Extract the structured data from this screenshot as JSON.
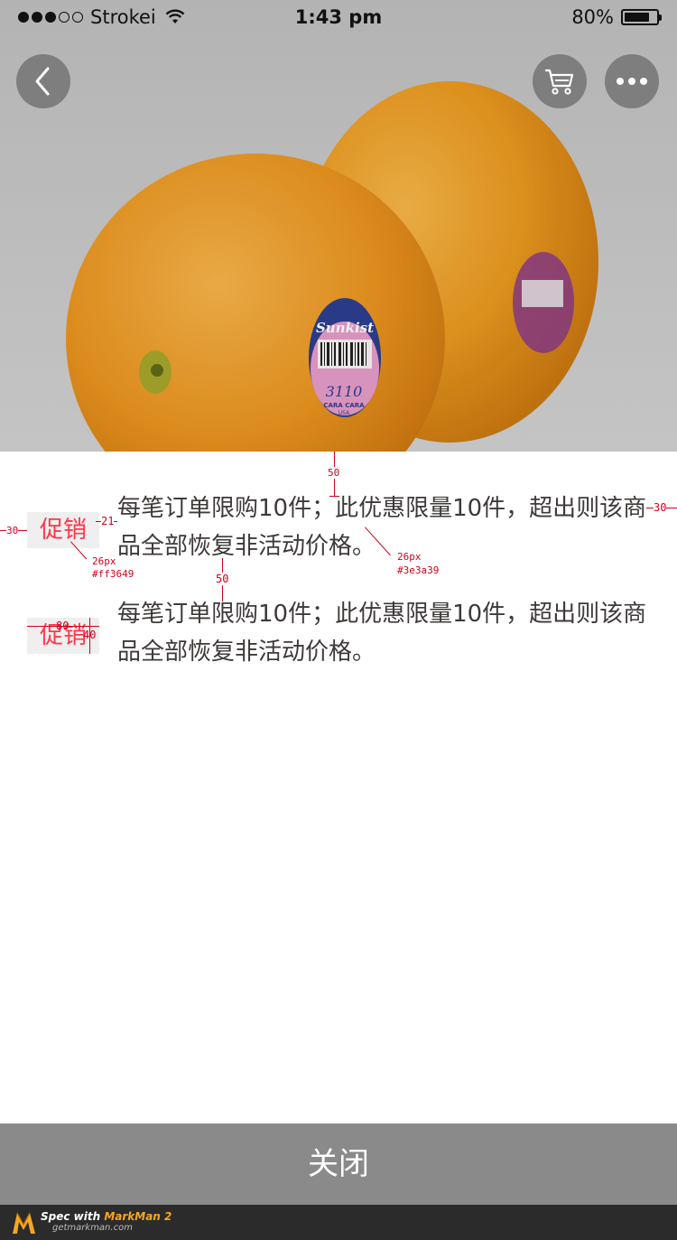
{
  "status_bar": {
    "carrier": "Strokei",
    "time": "1:43 pm",
    "battery": "80%",
    "battery_level": 0.8,
    "signal_bars": 3,
    "signal_total": 5
  },
  "hero": {
    "label_brand": "Sunkist",
    "label_code": "3110",
    "label_variety": "CARA CARA",
    "label_origin": "USA"
  },
  "promotions": [
    {
      "tag": "促销",
      "text": "每笔订单限购10件；此优惠限量10件，超出则该商品全部恢复非活动价格。"
    },
    {
      "tag": "促销",
      "text": "每笔订单限购10件；此优惠限量10件，超出则该商品全部恢复非活动价格。"
    }
  ],
  "annotations": {
    "gap_top": "50",
    "left_margin": "30",
    "tag_gap": "21",
    "right_margin": "30",
    "tag_font_size": "26px",
    "tag_color": "#ff3649",
    "text_font_size": "26px",
    "text_color": "#3e3a39",
    "row_gap": "50",
    "tag_width": "80",
    "tag_height": "40"
  },
  "footer": {
    "close_label": "关闭"
  },
  "watermark": {
    "title_prefix": "Spec with ",
    "title_brand": "MarkMan 2",
    "url": "getmarkman.com"
  },
  "colors": {
    "tag_text": "#ff3649",
    "tag_bg": "#efefef",
    "body_text": "#3e3a39",
    "close_bar": "#8a8a8a"
  }
}
